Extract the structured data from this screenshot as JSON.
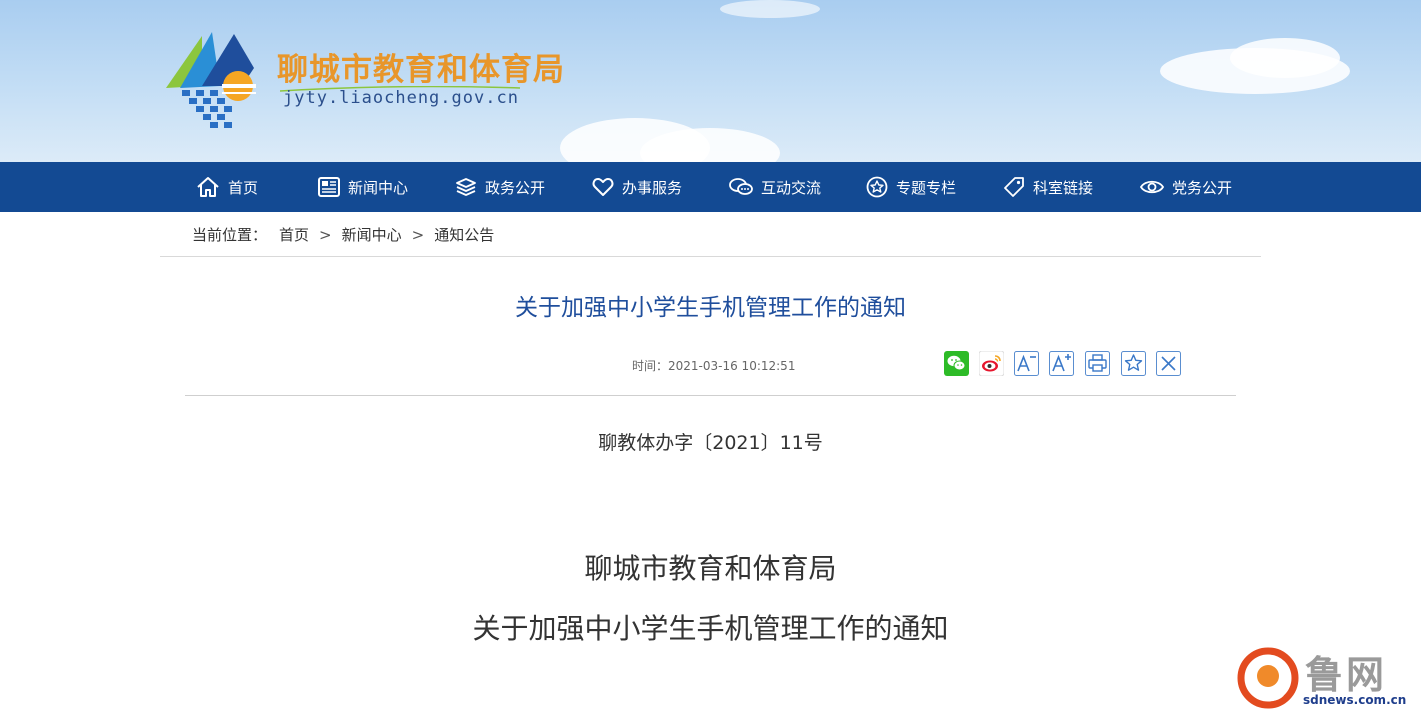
{
  "header": {
    "title": "聊城市教育和体育局",
    "domain": "jyty.liaocheng.gov.cn"
  },
  "nav": {
    "items": [
      {
        "label": "首页",
        "icon": "home-icon"
      },
      {
        "label": "新闻中心",
        "icon": "newspaper-icon"
      },
      {
        "label": "政务公开",
        "icon": "layers-icon"
      },
      {
        "label": "办事服务",
        "icon": "heart-icon"
      },
      {
        "label": "互动交流",
        "icon": "chat-icon"
      },
      {
        "label": "专题专栏",
        "icon": "star-circle-icon"
      },
      {
        "label": "科室链接",
        "icon": "tag-icon"
      },
      {
        "label": "党务公开",
        "icon": "eye-icon"
      }
    ]
  },
  "breadcrumb": {
    "prefix": "当前位置：",
    "items": [
      "首页",
      "新闻中心",
      "通知公告"
    ],
    "separator": ">"
  },
  "article": {
    "title": "关于加强中小学生手机管理工作的通知",
    "time": "时间：2021-03-16 10:12:51",
    "doc_number": "聊教体办字〔2021〕11号",
    "heading_line1": "聊城市教育和体育局",
    "heading_line2": "关于加强中小学生手机管理工作的通知"
  },
  "share_tools": [
    "wechat-icon",
    "weibo-icon",
    "font-decrease-icon",
    "font-increase-icon",
    "print-icon",
    "favorite-icon",
    "close-icon"
  ],
  "watermark": {
    "text": "鲁网",
    "sub": "sdnews.com.cn"
  },
  "colors": {
    "nav_bg": "#134a93",
    "title_orange": "#e8962a",
    "article_title": "#1f4e9c"
  }
}
